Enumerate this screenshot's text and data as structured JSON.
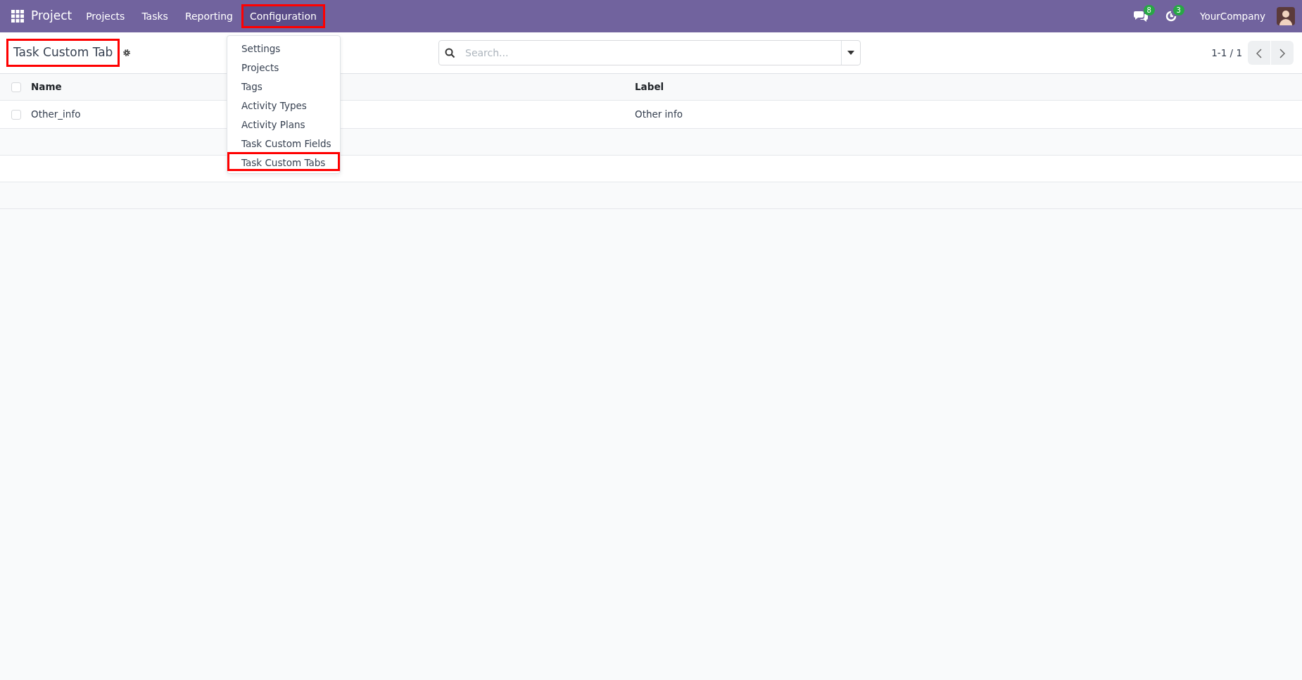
{
  "navbar": {
    "app_name": "Project",
    "menu": [
      {
        "label": "Projects",
        "expanded": false,
        "highlighted": false
      },
      {
        "label": "Tasks",
        "expanded": false,
        "highlighted": false
      },
      {
        "label": "Reporting",
        "expanded": false,
        "highlighted": false
      },
      {
        "label": "Configuration",
        "expanded": true,
        "highlighted": true
      }
    ],
    "messages_badge": "8",
    "activities_badge": "3",
    "company": "YourCompany"
  },
  "dropdown": {
    "items": [
      {
        "label": "Settings",
        "highlighted": false
      },
      {
        "label": "Projects",
        "highlighted": false
      },
      {
        "label": "Tags",
        "highlighted": false
      },
      {
        "label": "Activity Types",
        "highlighted": false
      },
      {
        "label": "Activity Plans",
        "highlighted": false
      },
      {
        "label": "Task Custom Fields",
        "highlighted": false
      },
      {
        "label": "Task Custom Tabs",
        "highlighted": true
      }
    ]
  },
  "control_panel": {
    "title": "Task Custom Tab",
    "title_highlighted": true,
    "search": {
      "placeholder": "Search..."
    },
    "pager": "1-1 / 1"
  },
  "table": {
    "columns": [
      "Name",
      "Label"
    ],
    "header_checked": false,
    "rows": [
      {
        "cells": [
          "Other_info",
          "Other info"
        ],
        "selected": false
      }
    ]
  }
}
